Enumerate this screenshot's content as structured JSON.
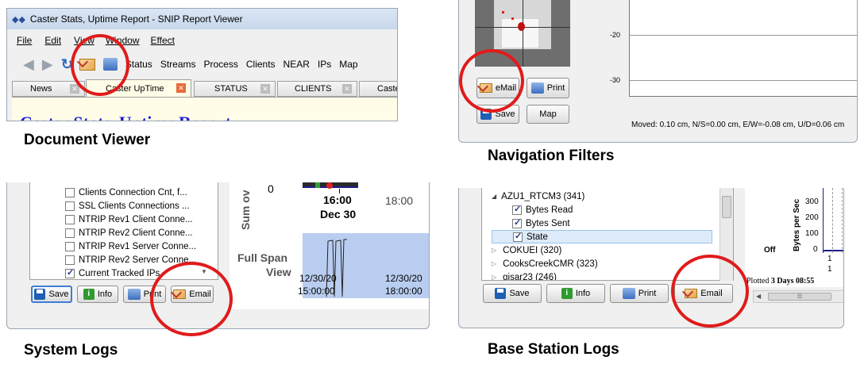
{
  "doc": {
    "title": "Caster Stats, Uptime Report - SNIP Report Viewer",
    "menu": [
      "File",
      "Edit",
      "View",
      "Window",
      "Effect"
    ],
    "toolbar": [
      "Status",
      "Streams",
      "Process",
      "Clients",
      "NEAR",
      "IPs",
      "Map"
    ],
    "tabs": [
      "News",
      "Caster UpTime",
      "STATUS",
      "CLIENTS",
      "Caster"
    ],
    "heading": "Caster Stats, Uptime Report",
    "caption": "Document Viewer"
  },
  "nav": {
    "ticks": [
      "-20",
      "-30"
    ],
    "email": "eMail",
    "print": "Print",
    "save": "Save",
    "map": "Map",
    "status": "Moved: 0.10 cm, N/S=0.00 cm, E/W=-0.08 cm, U/D=0.06 cm",
    "caption": "Navigation Filters"
  },
  "syslog": {
    "items": [
      {
        "label": "Clients Connection Cnt, f...",
        "checked": false
      },
      {
        "label": "SSL Clients Connections ...",
        "checked": false
      },
      {
        "label": "NTRIP Rev1 Client Conne...",
        "checked": false
      },
      {
        "label": "NTRIP Rev2 Client Conne...",
        "checked": false
      },
      {
        "label": "NTRIP Rev1 Server Conne...",
        "checked": false
      },
      {
        "label": "NTRIP Rev2 Server Conne...",
        "checked": false
      },
      {
        "label": "Current Tracked IPs",
        "checked": true
      }
    ],
    "save": "Save",
    "info": "Info",
    "print": "Print",
    "email": "Email",
    "axis_label": "Sum ov",
    "zero": "0",
    "time1": "16:00",
    "date1": "Dec 30",
    "time2": "18:00",
    "fullspan1": "Full Span",
    "fullspan2": "View",
    "span_d1": "12/30/20",
    "span_t1": "15:00:00",
    "span_d2": "12/30/20",
    "span_t2": "18:00:00",
    "caption": "System Logs"
  },
  "base": {
    "tree_root": "AZU1_RTCM3 (341)",
    "children": [
      {
        "label": "Bytes Read",
        "checked": true
      },
      {
        "label": "Bytes Sent",
        "checked": true
      },
      {
        "label": "State",
        "checked": true
      }
    ],
    "siblings": [
      "COKUEI (320)",
      "CooksCreekCMR (323)",
      "gisar23 (246)"
    ],
    "save": "Save",
    "info": "Info",
    "print": "Print",
    "email": "Email",
    "ylabel": "Bytes per Sec",
    "yticks": [
      "300",
      "200",
      "100",
      "0"
    ],
    "off": "Off",
    "plotted_prefix": "Plotted ",
    "plotted_value": "3 Days 08:55",
    "tick1": "1",
    "caption": "Base Station Logs"
  }
}
